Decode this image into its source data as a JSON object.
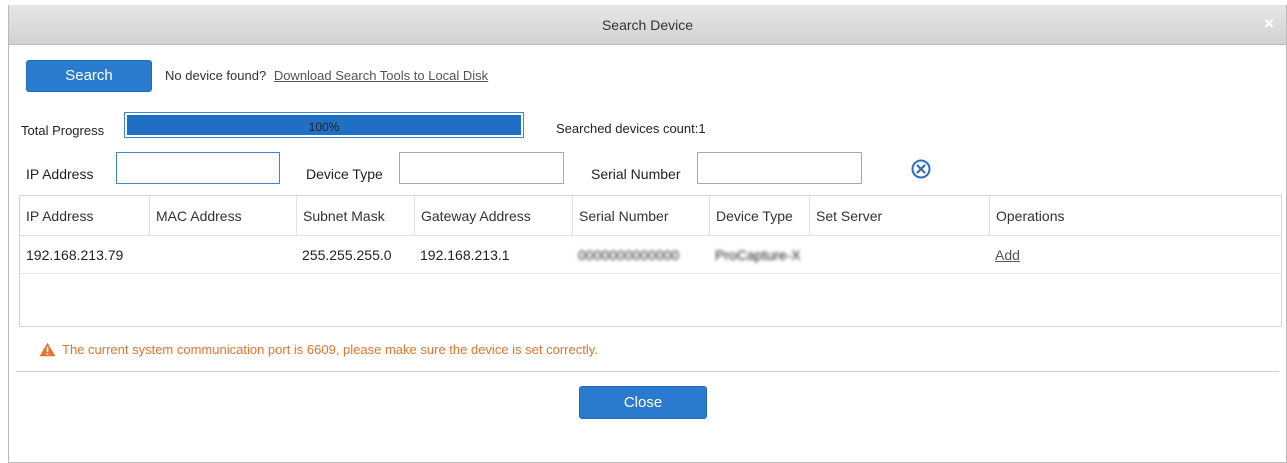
{
  "dialog": {
    "title": "Search Device",
    "close_glyph": "×"
  },
  "search": {
    "button_label": "Search",
    "hint_text": "No device found?",
    "download_link": "Download Search Tools to Local Disk"
  },
  "progress": {
    "label": "Total Progress",
    "value_text": "100%",
    "fraction": 1.0,
    "count_text": "Searched devices count:1"
  },
  "filters": {
    "ip_label": "IP Address",
    "ip_value": "",
    "type_label": "Device Type",
    "type_value": "",
    "serial_label": "Serial Number",
    "serial_value": "",
    "clear_icon": "clear-circle-icon"
  },
  "table": {
    "columns": [
      "IP Address",
      "MAC Address",
      "Subnet Mask",
      "Gateway Address",
      "Serial Number",
      "Device Type",
      "Set Server",
      "Operations"
    ],
    "rows": [
      {
        "ip": "192.168.213.79",
        "mac": "",
        "subnet": "255.255.255.0",
        "gateway": "192.168.213.1",
        "serial": "0000000000000",
        "device_type": "ProCapture-X",
        "set_server": "",
        "operation": "Add"
      }
    ]
  },
  "notice": {
    "text": "The current system communication port is 6609, please make sure the device is set correctly.",
    "color": "#e4742c"
  },
  "footer": {
    "close_label": "Close"
  },
  "colors": {
    "accent": "#2a7bd0",
    "progress": "#1f6fc4"
  }
}
